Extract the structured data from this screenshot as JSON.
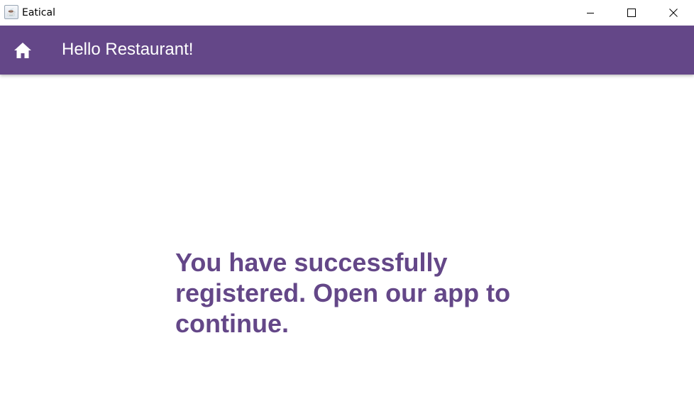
{
  "window": {
    "title": "Eatical",
    "icon": "java-coffee-cup-icon",
    "controls": [
      "minimize-icon",
      "maximize-icon",
      "close-icon"
    ]
  },
  "toolbar": {
    "home_icon": "home-icon",
    "title": "Hello Restaurant!"
  },
  "main": {
    "message": "You have successfully registered. Open our app to continue."
  },
  "colors": {
    "primary": "#644788",
    "background": "#ffffff",
    "toolbar_text": "#ffffff"
  }
}
